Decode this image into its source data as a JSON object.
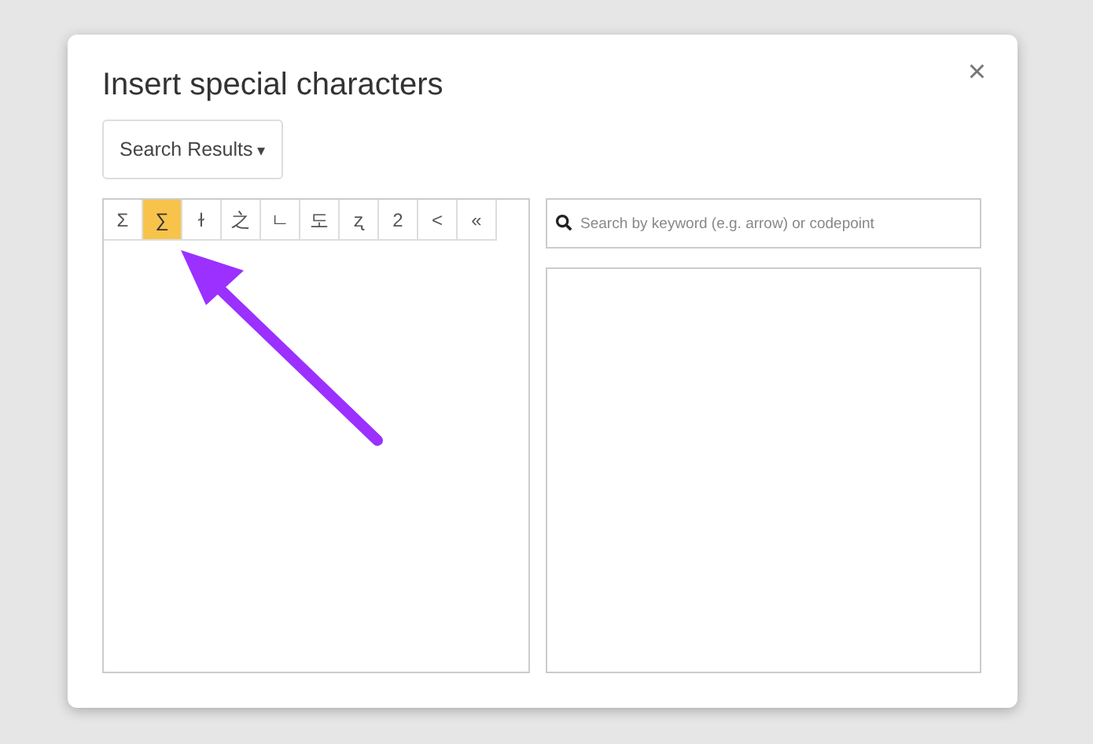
{
  "dialog": {
    "title": "Insert special characters",
    "close": "×"
  },
  "category": {
    "label": "Search Results",
    "caret": "▾"
  },
  "characters": [
    {
      "char": "Σ",
      "selected": false
    },
    {
      "char": "∑",
      "selected": true
    },
    {
      "char": "ɫ",
      "selected": false
    },
    {
      "char": "之",
      "selected": false
    },
    {
      "char": "ㄴ",
      "selected": false
    },
    {
      "char": "도",
      "selected": false
    },
    {
      "char": "ʐ",
      "selected": false
    },
    {
      "char": "2",
      "selected": false
    },
    {
      "char": "<",
      "selected": false
    },
    {
      "char": "«",
      "selected": false
    }
  ],
  "search": {
    "placeholder": "Search by keyword (e.g. arrow) or codepoint"
  }
}
